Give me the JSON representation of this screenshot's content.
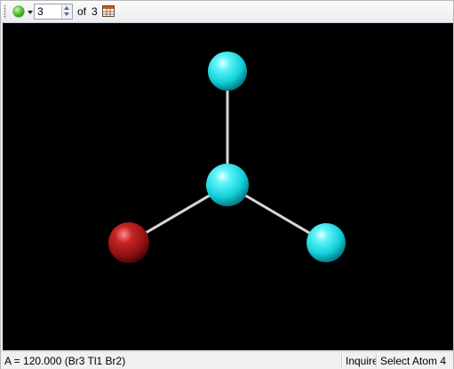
{
  "toolbar": {
    "model_button_icon": "green-sphere-icon",
    "current_value": "3",
    "of_label": "of",
    "total": "3",
    "table_icon": "table-icon"
  },
  "viewer": {
    "background": "#000000",
    "atom_colors": {
      "Tl": "#1ee0e8",
      "Br_cyan": "#1ee0e8",
      "Br_red": "#b01818"
    },
    "bond_color": "#d8d8d8"
  },
  "status": {
    "message": "A = 120.000 (Br3 Tl1 Br2)",
    "mode": "Inquire",
    "action": "Select Atom 4"
  }
}
